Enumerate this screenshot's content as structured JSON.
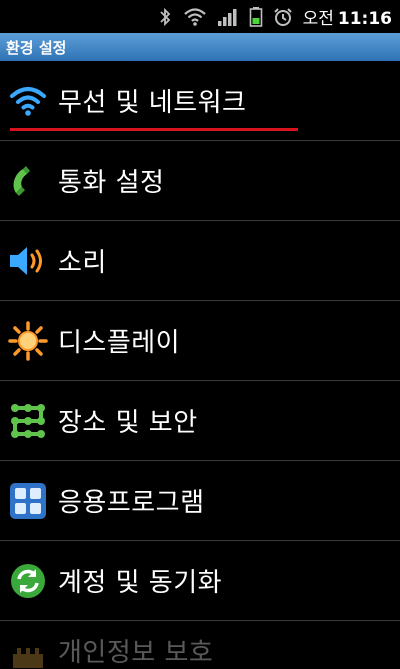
{
  "status": {
    "ampm": "오전",
    "time": "11:16"
  },
  "title": "환경 설정",
  "items": [
    {
      "label": "무선 및 네트워크",
      "icon": "wifi-icon"
    },
    {
      "label": "통화 설정",
      "icon": "phone-handset-icon"
    },
    {
      "label": "소리",
      "icon": "speaker-icon"
    },
    {
      "label": "디스플레이",
      "icon": "brightness-icon"
    },
    {
      "label": "장소 및 보안",
      "icon": "lock-pattern-icon"
    },
    {
      "label": "응용프로그램",
      "icon": "apps-grid-icon"
    },
    {
      "label": "계정 및 동기화",
      "icon": "sync-icon"
    },
    {
      "label": "개인정보 보호",
      "icon": "privacy-icon"
    }
  ],
  "colors": {
    "title_bar": "#4b8fcf",
    "highlight": "#d7131d",
    "divider": "#3a3a3a"
  }
}
